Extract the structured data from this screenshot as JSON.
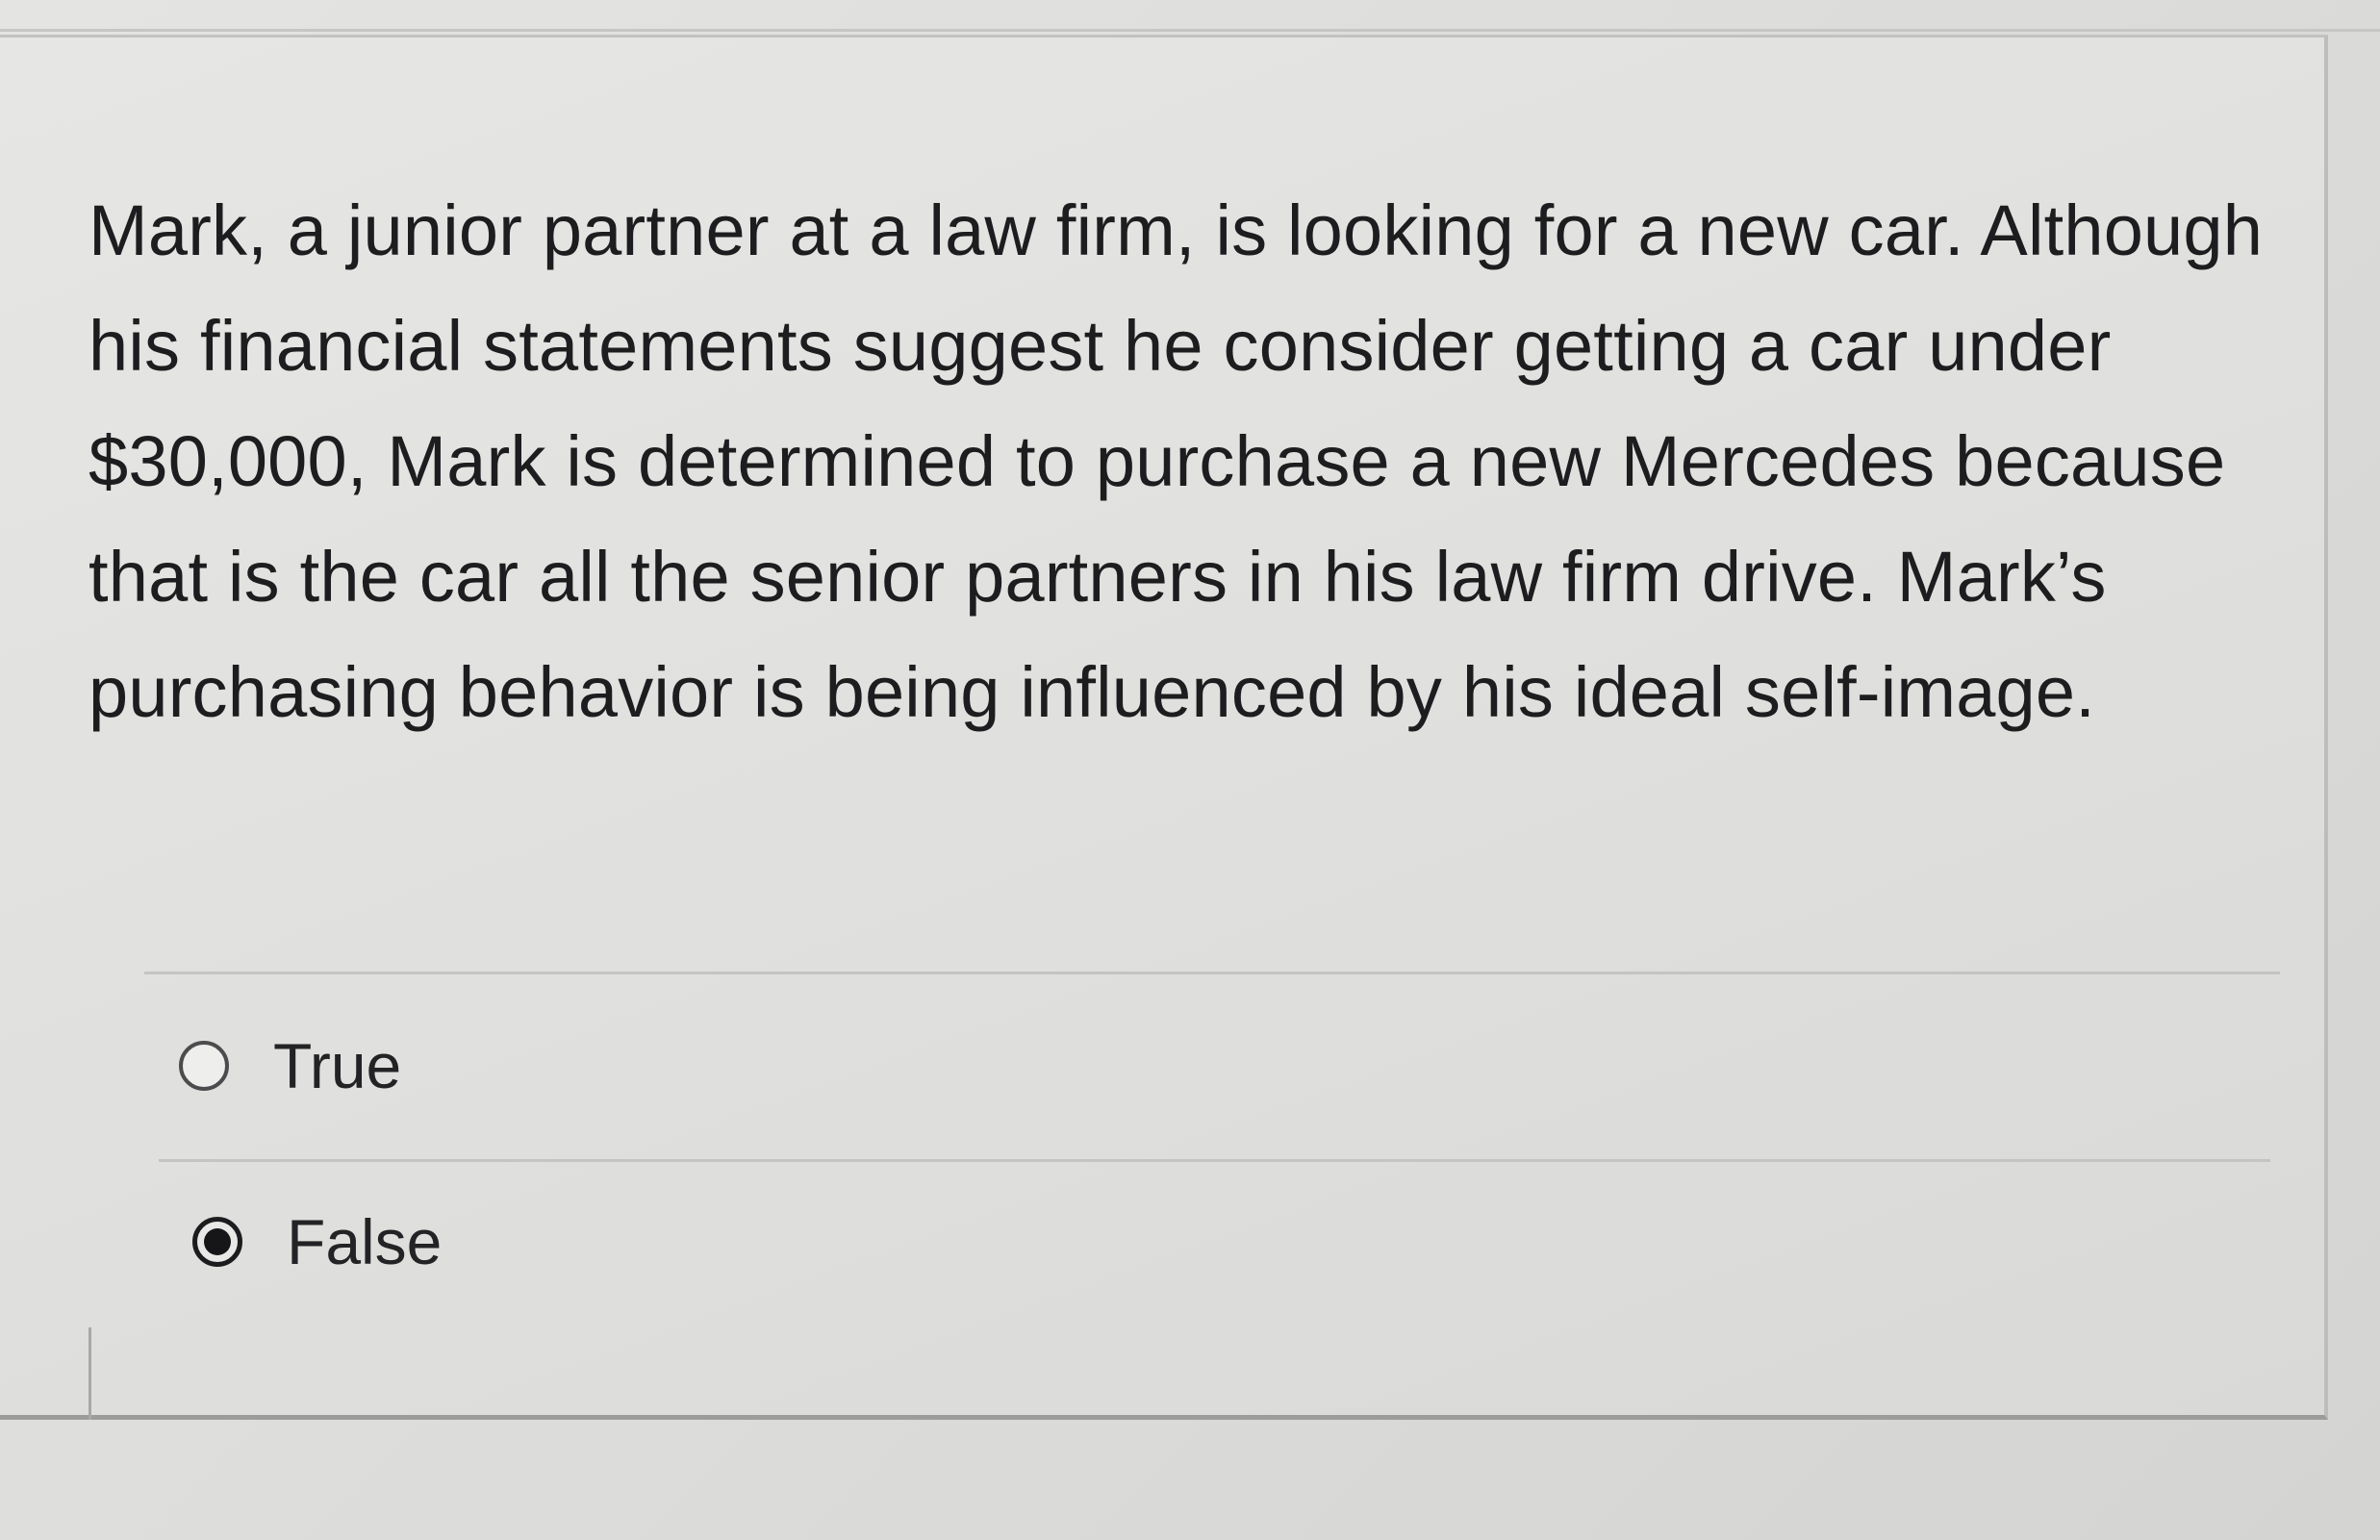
{
  "question": {
    "text": "Mark, a junior partner at a law firm, is looking for a new car. Although his financial statements suggest he consider getting a car under $30,000, Mark is determined to purchase a new Mercedes because that is the car all the senior partners in his law firm drive. Mark’s purchasing behavior is being influenced by his ideal self-image."
  },
  "options": [
    {
      "label": "True",
      "selected": false
    },
    {
      "label": "False",
      "selected": true
    }
  ]
}
